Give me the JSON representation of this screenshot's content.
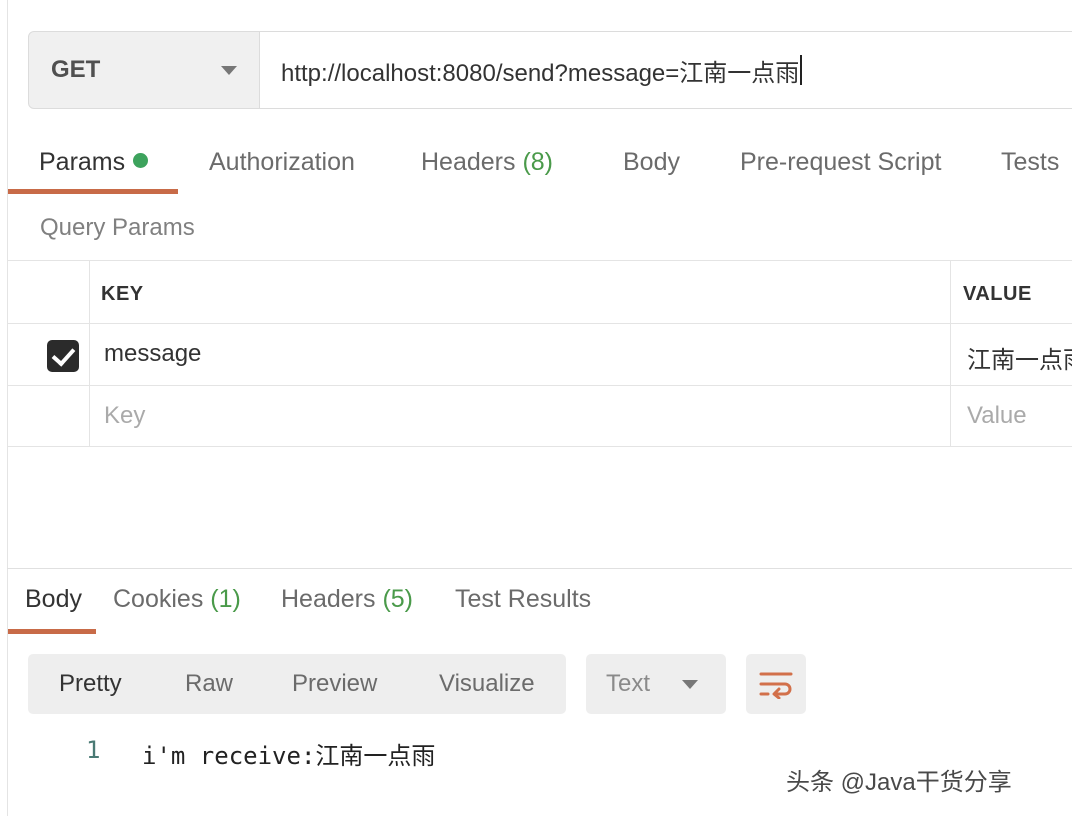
{
  "request": {
    "method": "GET",
    "url": "http://localhost:8080/send?message=江南一点雨"
  },
  "request_tabs": {
    "params": "Params",
    "authorization": "Authorization",
    "headers": "Headers",
    "headers_count": "(8)",
    "body": "Body",
    "pre_request": "Pre-request Script",
    "tests": "Tests"
  },
  "query_params": {
    "title": "Query Params",
    "columns": {
      "key": "KEY",
      "value": "VALUE"
    },
    "rows": [
      {
        "checked": true,
        "key": "message",
        "value": "江南一点雨"
      }
    ],
    "placeholder": {
      "key": "Key",
      "value": "Value"
    }
  },
  "response_tabs": {
    "body": "Body",
    "cookies": "Cookies",
    "cookies_count": "(1)",
    "headers": "Headers",
    "headers_count": "(5)",
    "test_results": "Test Results"
  },
  "view_modes": {
    "pretty": "Pretty",
    "raw": "Raw",
    "preview": "Preview",
    "visualize": "Visualize",
    "format": "Text"
  },
  "response_body": {
    "line_number": "1",
    "line_text": "i'm receive:江南一点雨"
  },
  "watermark": "头条 @Java干货分享",
  "colors": {
    "accent_underline": "#c86b48",
    "status_dot": "#3da35d",
    "count_green": "#4a9a4a"
  }
}
